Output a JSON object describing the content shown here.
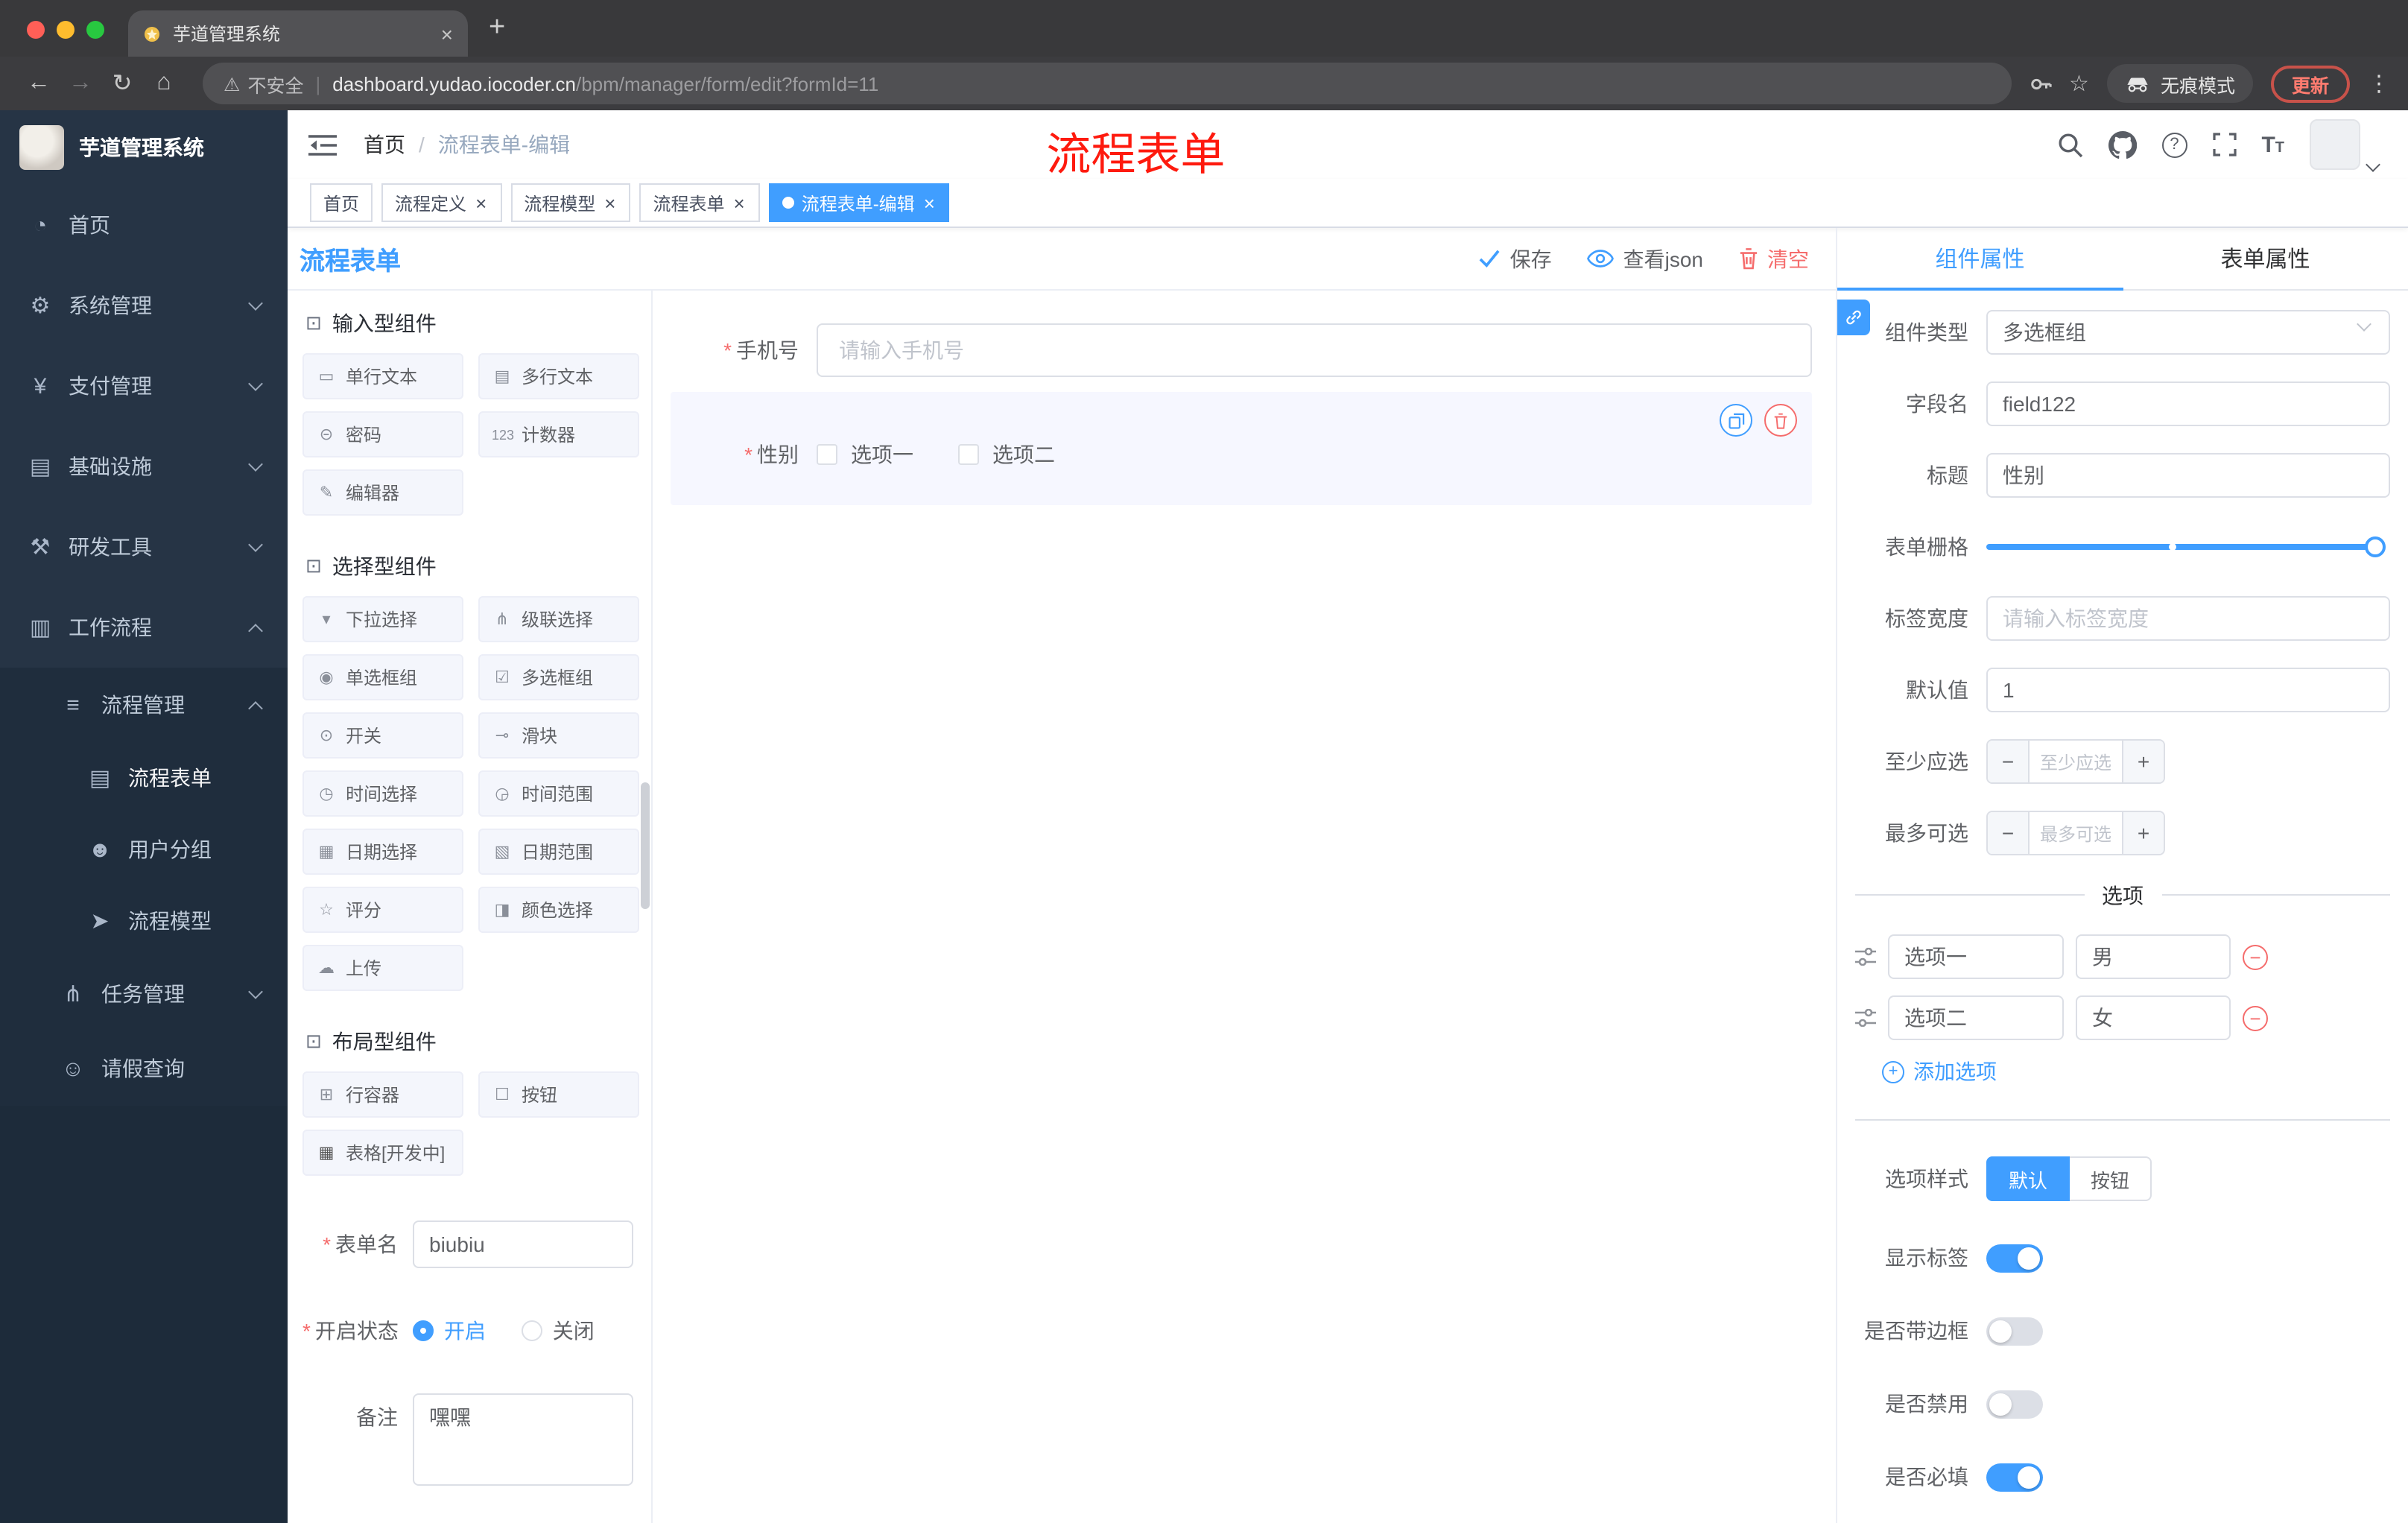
{
  "browser": {
    "tab_title": "芋道管理系统",
    "address": {
      "warning": "不安全",
      "host": "dashboard.yudao.iocoder.cn",
      "path": "/bpm/manager/form/edit?formId=11"
    },
    "incognito_label": "无痕模式",
    "update_label": "更新"
  },
  "annotation": {
    "text": "流程表单",
    "color": "#fe1a0e"
  },
  "sidebar": {
    "logo_title": "芋道管理系统",
    "menu": [
      {
        "label": "首页",
        "icon": "◔"
      },
      {
        "label": "系统管理",
        "icon": "⚙"
      },
      {
        "label": "支付管理",
        "icon": "¥"
      },
      {
        "label": "基础设施",
        "icon": "▤"
      },
      {
        "label": "研发工具",
        "icon": "⚒"
      },
      {
        "label": "工作流程",
        "icon": "▥"
      }
    ],
    "sub": {
      "process": {
        "label": "流程管理",
        "icon": "≡"
      },
      "children": [
        {
          "label": "流程表单",
          "icon": "▤"
        },
        {
          "label": "用户分组",
          "icon": "☻"
        },
        {
          "label": "流程模型",
          "icon": "➤"
        }
      ],
      "task": {
        "label": "任务管理",
        "icon": "⋔"
      },
      "leave": {
        "label": "请假查询",
        "icon": "☺"
      }
    }
  },
  "header": {
    "breadcrumb_root": "首页",
    "breadcrumb_sep": "/",
    "breadcrumb_current": "流程表单-编辑"
  },
  "tags": [
    {
      "label": "首页"
    },
    {
      "label": "流程定义"
    },
    {
      "label": "流程模型"
    },
    {
      "label": "流程表单"
    },
    {
      "label": "流程表单-编辑"
    }
  ],
  "designer": {
    "title": "流程表单",
    "actions": {
      "save": "保存",
      "view_json": "查看json",
      "clear": "清空"
    }
  },
  "palette": {
    "sections": [
      {
        "title": "输入型组件",
        "items": [
          {
            "label": "单行文本",
            "icon": "▭"
          },
          {
            "label": "多行文本",
            "icon": "▤"
          },
          {
            "label": "密码",
            "icon": "⊝"
          },
          {
            "label": "计数器",
            "icon": "123"
          },
          {
            "label": "编辑器",
            "icon": "✎"
          }
        ]
      },
      {
        "title": "选择型组件",
        "items": [
          {
            "label": "下拉选择",
            "icon": "▾"
          },
          {
            "label": "级联选择",
            "icon": "⋔"
          },
          {
            "label": "单选框组",
            "icon": "◉"
          },
          {
            "label": "多选框组",
            "icon": "☑"
          },
          {
            "label": "开关",
            "icon": "⊙"
          },
          {
            "label": "滑块",
            "icon": "⊸"
          },
          {
            "label": "时间选择",
            "icon": "◷"
          },
          {
            "label": "时间范围",
            "icon": "◶"
          },
          {
            "label": "日期选择",
            "icon": "▦"
          },
          {
            "label": "日期范围",
            "icon": "▧"
          },
          {
            "label": "评分",
            "icon": "☆"
          },
          {
            "label": "颜色选择",
            "icon": "◨"
          },
          {
            "label": "上传",
            "icon": "☁"
          }
        ]
      },
      {
        "title": "布局型组件",
        "items": [
          {
            "label": "行容器",
            "icon": "⊞"
          },
          {
            "label": "按钮",
            "icon": "☐"
          },
          {
            "label": "表格[开发中]",
            "icon": "▦"
          }
        ]
      }
    ]
  },
  "meta": {
    "form_name_label": "表单名",
    "form_name_value": "biubiu",
    "status_label": "开启状态",
    "status_on": "开启",
    "status_off": "关闭",
    "remark_label": "备注",
    "remark_value": "嘿嘿"
  },
  "canvas": {
    "phone_label": "手机号",
    "phone_placeholder": "请输入手机号",
    "gender_label": "性别",
    "gender_opt1": "选项一",
    "gender_opt2": "选项二"
  },
  "props": {
    "tab_component": "组件属性",
    "tab_form": "表单属性",
    "rows": {
      "type_label": "组件类型",
      "type_value": "多选框组",
      "field_label": "字段名",
      "field_value": "field122",
      "title_label": "标题",
      "title_value": "性别",
      "grid_label": "表单栅格",
      "width_label": "标签宽度",
      "width_placeholder": "请输入标签宽度",
      "default_label": "默认值",
      "default_value": "1",
      "min_label": "至少应选",
      "min_placeholder": "至少应选",
      "max_label": "最多可选",
      "max_placeholder": "最多可选"
    },
    "options": {
      "divider_label": "选项",
      "rows": [
        {
          "name": "选项一",
          "value": "男"
        },
        {
          "name": "选项二",
          "value": "女"
        }
      ],
      "add_label": "添加选项"
    },
    "style_label": "选项样式",
    "style_default": "默认",
    "style_button": "按钮",
    "switches": [
      {
        "label": "显示标签",
        "on": true
      },
      {
        "label": "是否带边框",
        "on": false
      },
      {
        "label": "是否禁用",
        "on": false
      },
      {
        "label": "是否必填",
        "on": true
      }
    ]
  }
}
